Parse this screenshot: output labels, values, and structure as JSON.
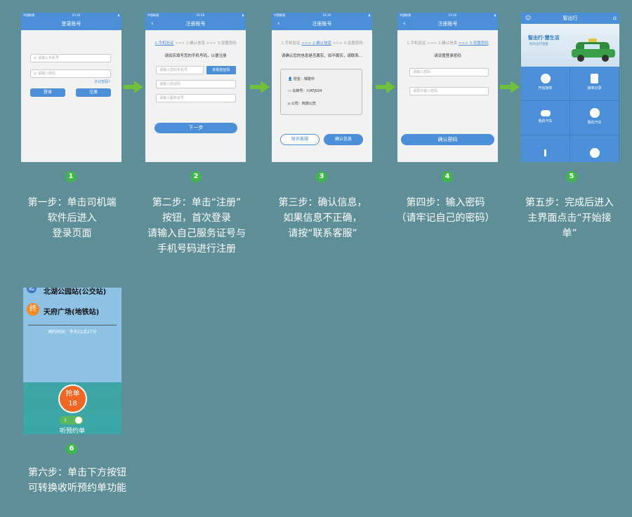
{
  "steps": [
    {
      "badge": "1",
      "caption": "第一步：单击司机端\n软件后进入\n登录页面"
    },
    {
      "badge": "2",
      "caption": "第二步：单击“注册”\n按钮，首次登录\n请输入自己服务证号与\n手机号码进行注册"
    },
    {
      "badge": "3",
      "caption": "第三步：确认信息，\n如果信息不正确，\n请按“联系客服”"
    },
    {
      "badge": "4",
      "caption": "第四步：输入密码\n（请牢记自己的密码）"
    },
    {
      "badge": "5",
      "caption": "第五步：完成后进入\n主界面点击“开始接\n单”"
    },
    {
      "badge": "6",
      "caption": "第六步：单击下方按钮\n可转换收听预约单功能"
    }
  ],
  "status": {
    "carrier": "中国联通",
    "time": "23:16"
  },
  "phone1": {
    "title": "登录账号",
    "phone_placeholder": "请输入手机号",
    "password_placeholder": "请输入密码",
    "forgot": "忘记密码?",
    "login": "登录",
    "register": "注册"
  },
  "phone2": {
    "title": "注册账号",
    "step1": "1.手机验证",
    "step2": ">>> 2.确认信息",
    "step3": ">>> 3.设置密码",
    "hint": "请如实填写您的手机号码，以便注册",
    "phone_placeholder": "请输入您的手机号",
    "get_code": "获取验证码",
    "code_placeholder": "请输入验证码",
    "cert_placeholder": "请输入服务证号",
    "next": "下一步"
  },
  "phone3": {
    "title": "注册账号",
    "hint": "请确认您的信息是否属实，如不属实，请联系...",
    "name": "姓名：邹建中",
    "plate": "车牌号：川ATJ024",
    "company": "公司：商旅公司",
    "contact": "联系客服",
    "confirm": "确认信息"
  },
  "phone4": {
    "title": "注册账号",
    "hint": "请设置登录密码",
    "pwd_placeholder": "请输入密码",
    "pwd2_placeholder": "请再次输入密码",
    "confirm": "确认密码"
  },
  "phone5": {
    "title": "智出行",
    "banner": "智出行·慧生活",
    "banner_sub": "你的出行管家",
    "cells": [
      "开始接单",
      "接单记录",
      "我的汽车",
      "我的汽车",
      "",
      ""
    ]
  },
  "phone6": {
    "start": "北湖公园站(公交站)",
    "end_tag": "终",
    "end": "天府广场(地铁站)",
    "time": "预约时间：今天22点27分",
    "grab": "抢单",
    "count": "18",
    "toggle": "听预约单"
  },
  "colors": {
    "bg": "#5e8f98",
    "accent": "#4a8fd8",
    "arrow": "#6fc13a",
    "badge": "#3fb54a",
    "grab": "#f26522"
  }
}
